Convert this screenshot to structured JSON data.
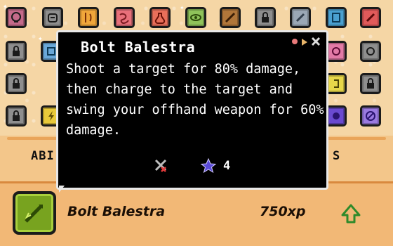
{
  "tooltip": {
    "title": "Bolt Balestra",
    "description": "Shoot a target for 80% damage, then charge to the target and swing your offhand weapon for 60% damage.",
    "charge_count": "4",
    "header_icons": [
      "sparkle-icon",
      "arrow-icon",
      "close-icon"
    ],
    "footer_icons": [
      "weapon-crossed-icon",
      "star-icon"
    ]
  },
  "tabs": {
    "left_label": "ABI",
    "right_label": "S"
  },
  "selected_skill": {
    "name": "Bolt Balestra",
    "cost": "750xp",
    "icon": "bolt-spear-icon",
    "action_icon": "upgrade-arrow-icon"
  },
  "grid_icons": [
    "skull-icon",
    "helmet-icon",
    "weapon-icon",
    "swirl-icon",
    "potion-icon",
    "eye-icon",
    "sword-icon",
    "lock-icon",
    "dagger-icon",
    "book-icon",
    "blade-icon",
    "lock-icon",
    "scroll-icon",
    "rune-icon",
    "lock-icon",
    "lock-icon",
    "lock-icon",
    "lock-icon",
    "lock-icon",
    "lightning-icon",
    "orb-icon",
    "no-icon"
  ],
  "colors": {
    "accent_green": "#78a31f",
    "tooltip_bg": "#000000",
    "panel_tan": "#f2b876"
  }
}
